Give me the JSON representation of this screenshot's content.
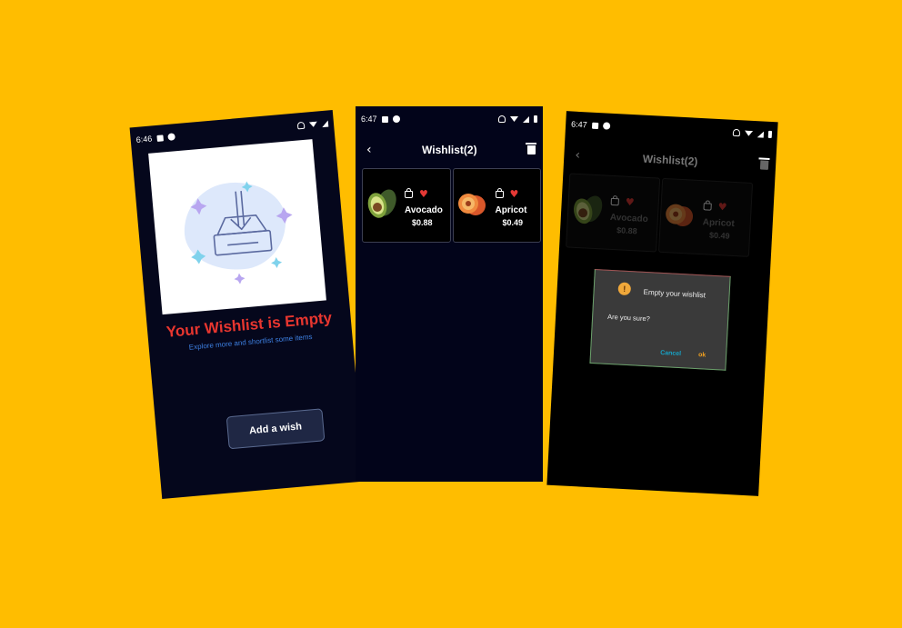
{
  "colors": {
    "background": "#ffbd00",
    "empty_title": "#e8362f",
    "subtitle": "#3d7fe0",
    "heart": "#e53935",
    "cancel": "#16a3c6",
    "ok": "#f0a020"
  },
  "screen1": {
    "status_time": "6:46",
    "empty_title": "Your Wishlist is Empty",
    "empty_subtitle": "Explore more and shortlist some items",
    "add_button": "Add a wish"
  },
  "screen2": {
    "status_time": "6:47",
    "title": "Wishlist(2)",
    "items": [
      {
        "name": "Avocado",
        "price": "$0.88"
      },
      {
        "name": "Apricot",
        "price": "$0.49"
      }
    ]
  },
  "screen3": {
    "status_time": "6:47",
    "title": "Wishlist(2)",
    "items": [
      {
        "name": "Avocado",
        "price": "$0.88"
      },
      {
        "name": "Apricot",
        "price": "$0.49"
      }
    ],
    "dialog": {
      "title": "Empty your wishlist",
      "message": "Are you sure?",
      "cancel": "Cancel",
      "ok": "ok"
    }
  }
}
